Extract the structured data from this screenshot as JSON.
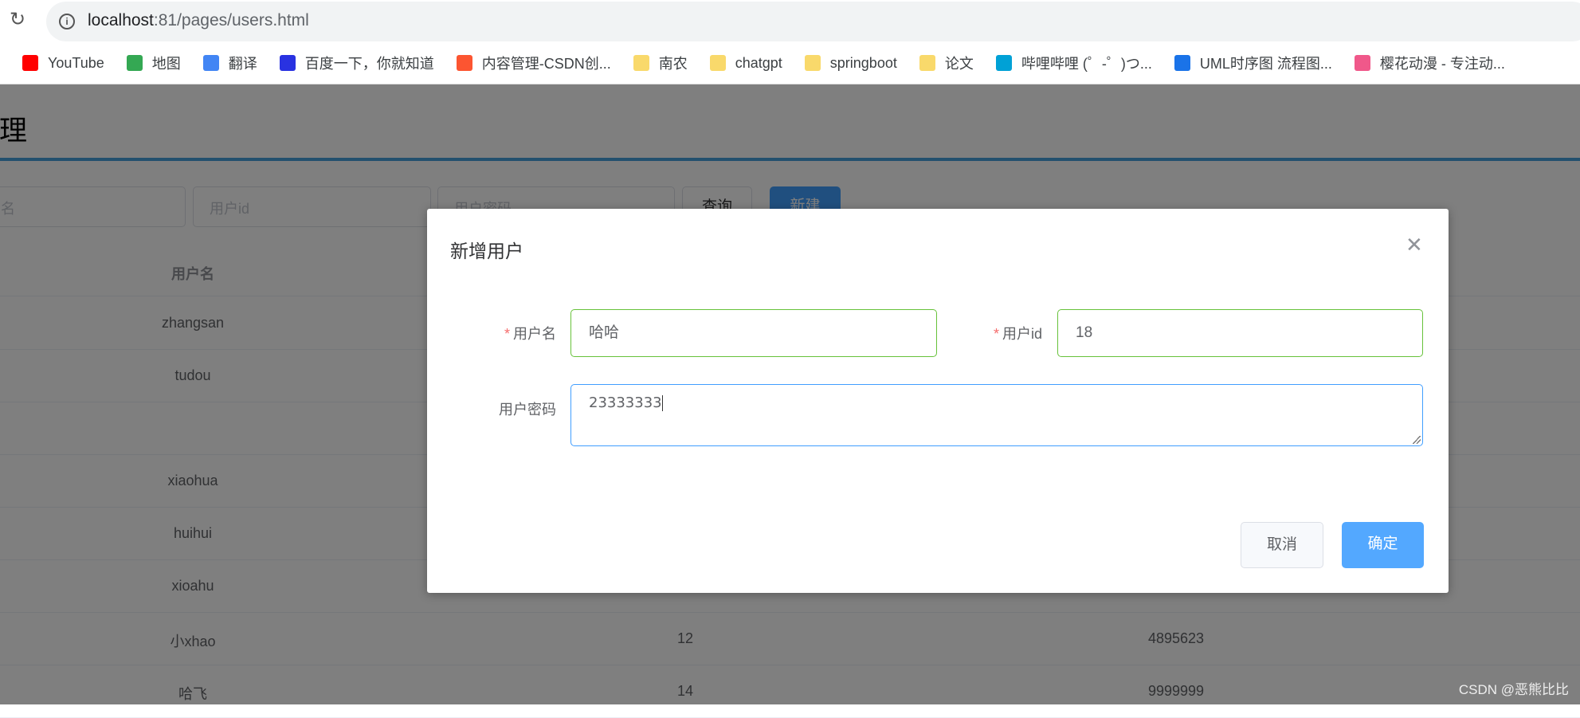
{
  "browser": {
    "url_host": "localhost",
    "url_rest": ":81/pages/users.html",
    "bookmarks": [
      {
        "label": "YouTube",
        "icon": "youtube-icon",
        "color": "#ff0000"
      },
      {
        "label": "地图",
        "icon": "maps-icon",
        "color": "#34a853"
      },
      {
        "label": "翻译",
        "icon": "translate-icon",
        "color": "#4285f4"
      },
      {
        "label": "百度一下，你就知道",
        "icon": "baidu-icon",
        "color": "#2932e1"
      },
      {
        "label": "内容管理-CSDN创...",
        "icon": "csdn-icon",
        "color": "#fc5531"
      },
      {
        "label": "南农",
        "icon": "folder-icon",
        "color": "#f9d96b"
      },
      {
        "label": "chatgpt",
        "icon": "folder-icon",
        "color": "#f9d96b"
      },
      {
        "label": "springboot",
        "icon": "folder-icon",
        "color": "#f9d96b"
      },
      {
        "label": "论文",
        "icon": "folder-icon",
        "color": "#f9d96b"
      },
      {
        "label": "哔哩哔哩 (゜-゜)つ...",
        "icon": "bilibili-icon",
        "color": "#00a1d6"
      },
      {
        "label": "UML时序图 流程图...",
        "icon": "processon-icon",
        "color": "#1a73e8"
      },
      {
        "label": "樱花动漫 - 专注动...",
        "icon": "sakura-icon",
        "color": "#f0588a"
      }
    ]
  },
  "page": {
    "title": "管理",
    "search": {
      "name_placeholder": "名",
      "id_placeholder": "用户id",
      "pwd_placeholder": "用户密码",
      "query_label": "查询",
      "new_label": "新建"
    },
    "table": {
      "header": [
        "用户名"
      ],
      "rows": [
        {
          "name": "zhangsan",
          "id": "",
          "pwd": ""
        },
        {
          "name": "tudou",
          "id": "",
          "pwd": ""
        },
        {
          "name": "",
          "id": "",
          "pwd": ""
        },
        {
          "name": "xiaohua",
          "id": "",
          "pwd": ""
        },
        {
          "name": "huihui",
          "id": "",
          "pwd": ""
        },
        {
          "name": "xioahu",
          "id": "",
          "pwd": ""
        },
        {
          "name": "小xhao",
          "id": "12",
          "pwd": "4895623"
        },
        {
          "name": "哈飞",
          "id": "14",
          "pwd": "9999999"
        }
      ]
    }
  },
  "dialog": {
    "title": "新增用户",
    "username_label": "用户名",
    "userid_label": "用户id",
    "password_label": "用户密码",
    "required_mark": "*",
    "username_value": "哈哈",
    "userid_value": "18",
    "password_value": "23333333",
    "cancel_label": "取消",
    "confirm_label": "确定"
  },
  "colors": {
    "primary": "#409eff",
    "success_border": "#67c23a"
  },
  "watermark": "CSDN @恶熊比比"
}
